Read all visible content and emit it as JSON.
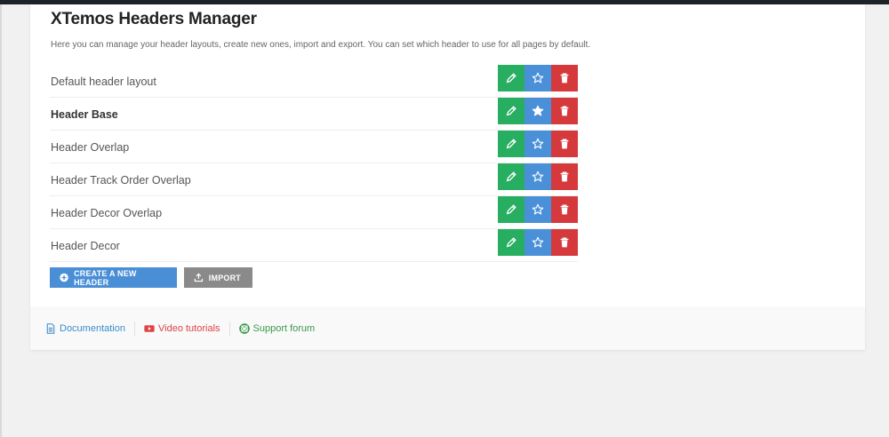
{
  "title": "XTemos Headers Manager",
  "description": "Here you can manage your header layouts, create new ones, import and export. You can set which header to use for all pages by default.",
  "headers": [
    {
      "name": "Default header layout",
      "is_default": false
    },
    {
      "name": "Header Base",
      "is_default": true
    },
    {
      "name": "Header Overlap",
      "is_default": false
    },
    {
      "name": "Header Track Order Overlap",
      "is_default": false
    },
    {
      "name": "Header Decor Overlap",
      "is_default": false
    },
    {
      "name": "Header Decor",
      "is_default": false
    }
  ],
  "buttons": {
    "create": "CREATE A NEW HEADER",
    "import": "IMPORT"
  },
  "footer": {
    "documentation": "Documentation",
    "video": "Video tutorials",
    "support": "Support forum"
  },
  "colors": {
    "edit": "#27ae60",
    "star": "#4a90d9",
    "delete": "#d6393c",
    "create": "#4a8fd6",
    "import": "#8a8a8a"
  },
  "icons": {
    "edit": "pencil-icon",
    "set_default": "star-icon",
    "delete": "trash-icon",
    "create": "plus-circle-icon",
    "import": "upload-icon"
  }
}
